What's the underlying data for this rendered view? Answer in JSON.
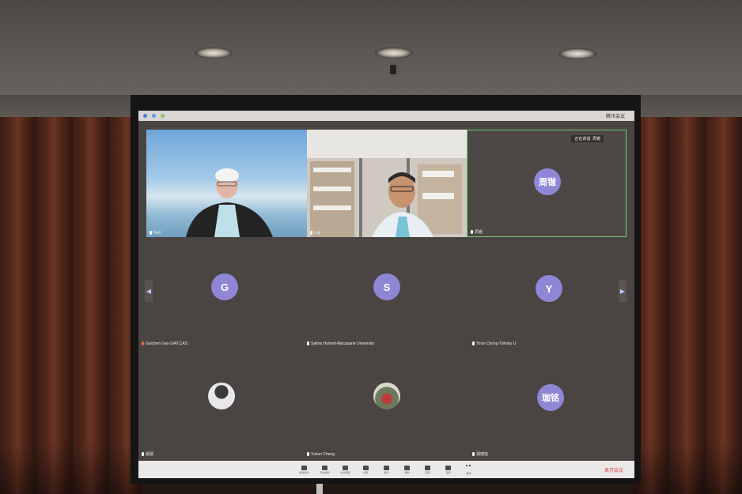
{
  "screen": {
    "app_title": "腾讯会议",
    "speaking_banner": "正在讲话: 周锴",
    "tiles": [
      {
        "name": "Rolf",
        "type": "video"
      },
      {
        "name": "Lab",
        "type": "video"
      },
      {
        "name": "周锴",
        "type": "avatar",
        "initial": "周锴",
        "active": true
      },
      {
        "name": "Guichen Gao-SIAT,CAS",
        "type": "avatar",
        "initial": "G"
      },
      {
        "name": "Salma Hamed-Macquarie University",
        "type": "avatar",
        "initial": "S"
      },
      {
        "name": "Yiran Chong-Tohoku U",
        "type": "avatar",
        "initial": "Y"
      },
      {
        "name": "晨晨",
        "type": "photo"
      },
      {
        "name": "Yukun Cheng",
        "type": "photo"
      },
      {
        "name": "胡珈铭",
        "type": "avatar",
        "initial": "珈铭"
      }
    ],
    "toolbar": {
      "items": [
        "解除静音",
        "开启视频",
        "共享屏幕",
        "成员",
        "聊天",
        "录制",
        "应用",
        "设置",
        "更多"
      ],
      "leave": "离开会议"
    }
  },
  "colors": {
    "avatar": "#8f86d6",
    "active_border": "#6fcf6f",
    "tile_bg": "#4a4443"
  }
}
